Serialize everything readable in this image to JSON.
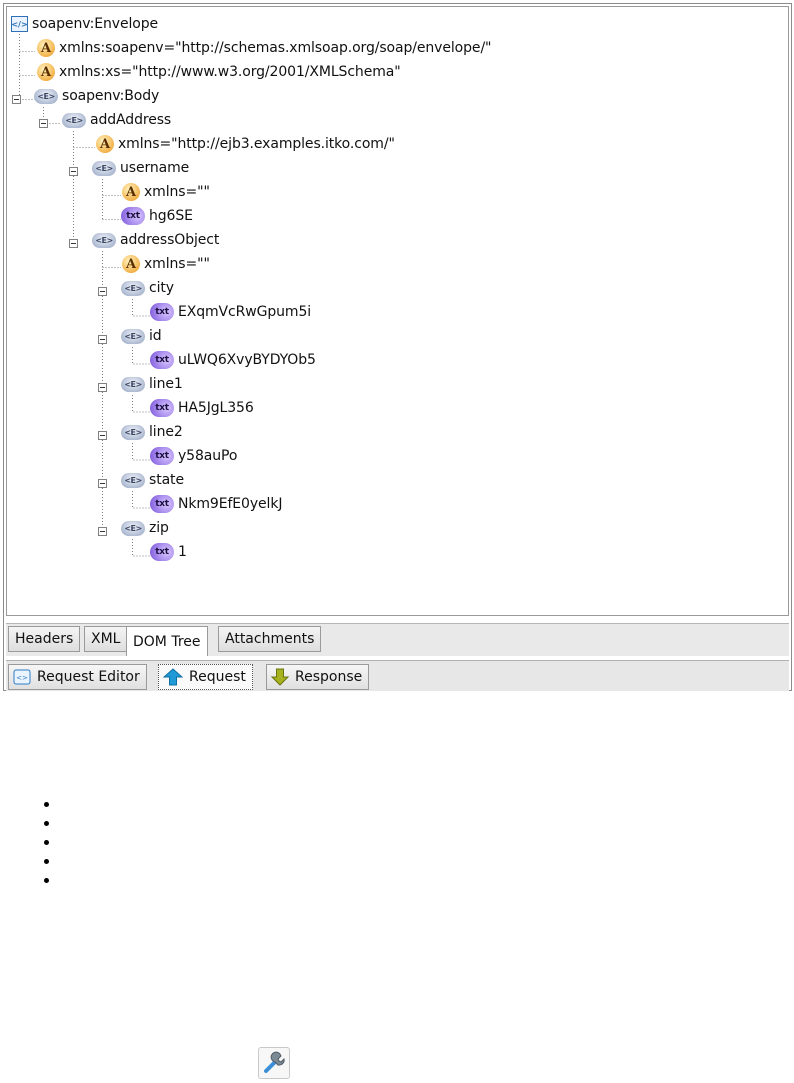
{
  "tree": {
    "root_label": "soapenv:Envelope",
    "nodes": [
      {
        "icon": "attribute-icon",
        "icon_text": "A",
        "label": "xmlns:soapenv=\"http://schemas.xmlsoap.org/soap/envelope/\""
      },
      {
        "icon": "attribute-icon",
        "icon_text": "A",
        "label": "xmlns:xs=\"http://www.w3.org/2001/XMLSchema\""
      },
      {
        "icon": "element-icon",
        "icon_text": "<E>",
        "label": "soapenv:Body"
      },
      {
        "icon": "element-icon",
        "icon_text": "<E>",
        "label": "addAddress"
      },
      {
        "icon": "attribute-icon",
        "icon_text": "A",
        "label": "xmlns=\"http://ejb3.examples.itko.com/\""
      },
      {
        "icon": "element-icon",
        "icon_text": "<E>",
        "label": "username"
      },
      {
        "icon": "attribute-icon",
        "icon_text": "A",
        "label": "xmlns=\"\""
      },
      {
        "icon": "text-node-icon",
        "icon_text": "txt",
        "label": "hg6SE"
      },
      {
        "icon": "element-icon",
        "icon_text": "<E>",
        "label": "addressObject"
      },
      {
        "icon": "attribute-icon",
        "icon_text": "A",
        "label": "xmlns=\"\""
      },
      {
        "icon": "element-icon",
        "icon_text": "<E>",
        "label": "city"
      },
      {
        "icon": "text-node-icon",
        "icon_text": "txt",
        "label": "EXqmVcRwGpum5i"
      },
      {
        "icon": "element-icon",
        "icon_text": "<E>",
        "label": "id"
      },
      {
        "icon": "text-node-icon",
        "icon_text": "txt",
        "label": "uLWQ6XvyBYDYOb5"
      },
      {
        "icon": "element-icon",
        "icon_text": "<E>",
        "label": "line1"
      },
      {
        "icon": "text-node-icon",
        "icon_text": "txt",
        "label": "HA5JgL356"
      },
      {
        "icon": "element-icon",
        "icon_text": "<E>",
        "label": "line2"
      },
      {
        "icon": "text-node-icon",
        "icon_text": "txt",
        "label": "y58auPo"
      },
      {
        "icon": "element-icon",
        "icon_text": "<E>",
        "label": "state"
      },
      {
        "icon": "text-node-icon",
        "icon_text": "txt",
        "label": "Nkm9EfE0yelkJ"
      },
      {
        "icon": "element-icon",
        "icon_text": "<E>",
        "label": "zip"
      },
      {
        "icon": "text-node-icon",
        "icon_text": "txt",
        "label": "1"
      }
    ]
  },
  "view_tabs": {
    "headers": "Headers",
    "xml": "XML",
    "dom_tree": "DOM Tree",
    "attachments": "Attachments",
    "selected": "DOM Tree"
  },
  "bottom_tabs": {
    "request_editor": "Request Editor",
    "request": "Request",
    "response": "Response",
    "selected": "Request"
  },
  "bullet_icon": "bullet-icon",
  "toolbar_icon": "wrench-icon",
  "colors": {
    "attribute": "#f3b24a",
    "element": "#aab7cf",
    "text_node": "#9b7be8",
    "request_arrow": "#1f9ad6",
    "response_arrow": "#8a9a1a"
  }
}
